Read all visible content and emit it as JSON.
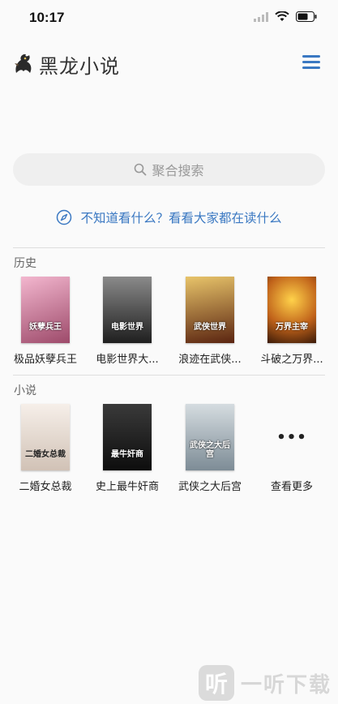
{
  "status": {
    "time": "10:17"
  },
  "header": {
    "title": "黑龙小说"
  },
  "search": {
    "placeholder": "聚合搜索"
  },
  "discover": {
    "text": "不知道看什么？看看大家都在读什么"
  },
  "history": {
    "title": "历史",
    "books": [
      {
        "title": "极品妖孽兵王",
        "cover_text": "妖孽兵王",
        "colors": [
          "#f1a7c4",
          "#9d4a6a"
        ]
      },
      {
        "title": "电影世界大...",
        "cover_text": "电影世界",
        "colors": [
          "#6b6b6b",
          "#1f1f1f"
        ]
      },
      {
        "title": "浪迹在武侠...",
        "cover_text": "武侠世界",
        "colors": [
          "#d9b15a",
          "#5a2410"
        ]
      },
      {
        "title": "斗破之万界...",
        "cover_text": "万界主宰",
        "colors": [
          "#f0b232",
          "#3a1a08"
        ]
      }
    ]
  },
  "novels": {
    "title": "小说",
    "books": [
      {
        "title": "二婚女总裁",
        "cover_text": "二婚女总裁",
        "colors": [
          "#f3ece6",
          "#c9b9ad"
        ]
      },
      {
        "title": "史上最牛奸商",
        "cover_text": "最牛奸商",
        "colors": [
          "#2b2b2b",
          "#0d0d0d"
        ]
      },
      {
        "title": "武侠之大后宫",
        "cover_text": "武侠之大后宫",
        "colors": [
          "#c7cfd4",
          "#7d8c96"
        ]
      }
    ],
    "more_label": "查看更多",
    "more_dots": "•••"
  },
  "watermark": {
    "badge": "听",
    "text": "一听下载"
  }
}
